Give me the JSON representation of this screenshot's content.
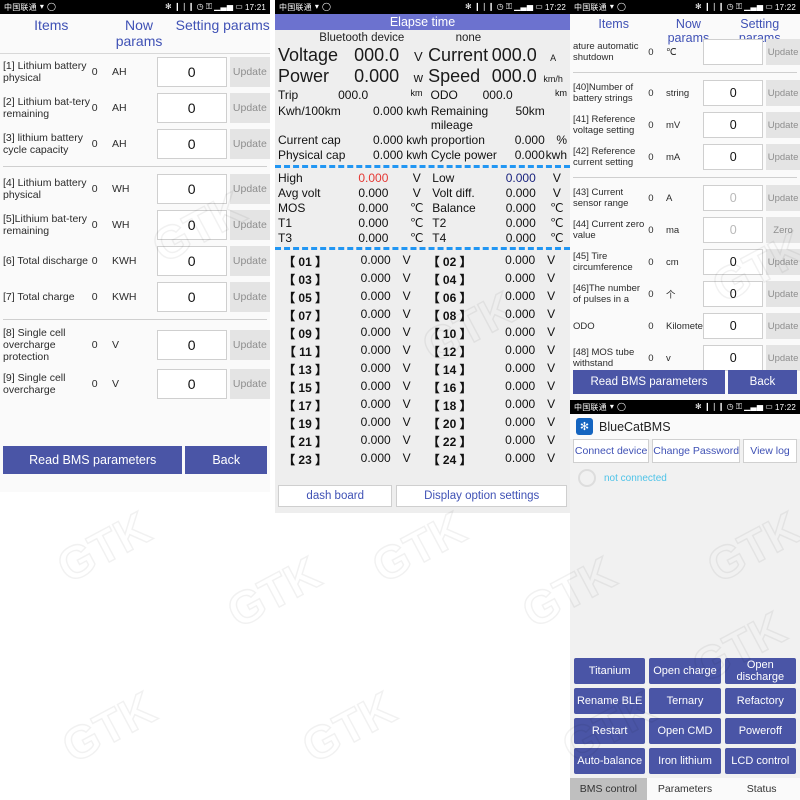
{
  "statusbar": {
    "carrier": "中国联通",
    "icons_left": [
      "signal-icon",
      "refresh-icon"
    ],
    "icons_right": [
      "bluetooth-icon",
      "vibrate-icon",
      "alarm-icon",
      "key-icon",
      "signal-bars-icon",
      "battery-icon"
    ],
    "time_left": "17:21",
    "time_right": "17:22"
  },
  "colors": {
    "accent": "#4a55a6",
    "header_text": "#3f51b5",
    "title_bar": "#6c72cf",
    "dash_divider": "#2196f3",
    "high_value": "#e53935",
    "low_value": "#1a237e",
    "status_text": "#4ec3e8",
    "logo": "#1565c0"
  },
  "panel_params_left": {
    "header": {
      "items": "Items",
      "now": "Now params",
      "setting": "Setting params"
    },
    "rows": [
      {
        "name": "[1] Lithium battery physical",
        "now": "0",
        "unit": "AH",
        "value": "0",
        "button": "Update"
      },
      {
        "name": "[2] Lithium bat-tery remaining",
        "now": "0",
        "unit": "AH",
        "value": "0",
        "button": "Update"
      },
      {
        "name": "[3] lithium battery cycle capacity",
        "now": "0",
        "unit": "AH",
        "value": "0",
        "button": "Update"
      },
      {
        "name": "[4] Lithium battery physical",
        "now": "0",
        "unit": "WH",
        "value": "0",
        "button": "Update"
      },
      {
        "name": "[5]Lithium bat-tery remaining",
        "now": "0",
        "unit": "WH",
        "value": "0",
        "button": "Update"
      },
      {
        "name": "[6] Total discharge",
        "now": "0",
        "unit": "KWH",
        "value": "0",
        "button": "Update"
      },
      {
        "name": "[7] Total charge",
        "now": "0",
        "unit": "KWH",
        "value": "0",
        "button": "Update"
      },
      {
        "name": "[8] Single cell overcharge protection",
        "now": "0",
        "unit": "V",
        "value": "0",
        "button": "Update"
      },
      {
        "name": "[9] Single cell overcharge",
        "now": "0",
        "unit": "V",
        "value": "0",
        "button": "Update"
      }
    ],
    "footer": {
      "read": "Read BMS parameters",
      "back": "Back"
    }
  },
  "panel_dashboard": {
    "title": "Elapse time",
    "bluetooth_label": "Bluetooth device",
    "bluetooth_value": "none",
    "rows_big": [
      {
        "l1": "Voltage",
        "v1": "000.0",
        "u1": "V",
        "l2": "Current",
        "v2": "000.0",
        "u2": "A"
      },
      {
        "l1": "Power",
        "v1": "0.000",
        "u1": "w",
        "l2": "Speed",
        "v2": "000.0",
        "u2": "km/h"
      }
    ],
    "row_trip": {
      "l1": "Trip",
      "v1": "000.0",
      "u1": "km",
      "l2": "ODO",
      "v2": "000.0",
      "u2": "km"
    },
    "rows_small": [
      {
        "l1": "Kwh/100km",
        "v1": "0.000",
        "u1": "kwh",
        "l2": "Remaining mileage",
        "v2": "50km",
        "u2": ""
      },
      {
        "l1": "Current cap",
        "v1": "0.000",
        "u1": "kwh",
        "l2": "proportion",
        "v2": "0.000",
        "u2": "%"
      },
      {
        "l1": "Physical cap",
        "v1": "0.000",
        "u1": "kwh",
        "l2": "Cycle power",
        "v2": "0.000",
        "u2": "kwh"
      }
    ],
    "stats": [
      {
        "l1": "High",
        "v1": "0.000",
        "u1": "V",
        "c1": "high",
        "l2": "Low",
        "v2": "0.000",
        "u2": "V",
        "c2": "low"
      },
      {
        "l1": "Avg volt",
        "v1": "0.000",
        "u1": "V",
        "c1": "",
        "l2": "Volt diff.",
        "v2": "0.000",
        "u2": "V",
        "c2": ""
      },
      {
        "l1": "MOS",
        "v1": "0.000",
        "u1": "℃",
        "c1": "",
        "l2": "Balance",
        "v2": "0.000",
        "u2": "℃",
        "c2": ""
      },
      {
        "l1": "T1",
        "v1": "0.000",
        "u1": "℃",
        "c1": "",
        "l2": "T2",
        "v2": "0.000",
        "u2": "℃",
        "c2": ""
      },
      {
        "l1": "T3",
        "v1": "0.000",
        "u1": "℃",
        "c1": "",
        "l2": "T4",
        "v2": "0.000",
        "u2": "℃",
        "c2": ""
      }
    ],
    "cells": [
      {
        "i1": "【 01 】",
        "v1": "0.000",
        "u1": "V",
        "i2": "【 02 】",
        "v2": "0.000",
        "u2": "V"
      },
      {
        "i1": "【 03 】",
        "v1": "0.000",
        "u1": "V",
        "i2": "【 04 】",
        "v2": "0.000",
        "u2": "V"
      },
      {
        "i1": "【 05 】",
        "v1": "0.000",
        "u1": "V",
        "i2": "【 06 】",
        "v2": "0.000",
        "u2": "V"
      },
      {
        "i1": "【 07 】",
        "v1": "0.000",
        "u1": "V",
        "i2": "【 08 】",
        "v2": "0.000",
        "u2": "V"
      },
      {
        "i1": "【 09 】",
        "v1": "0.000",
        "u1": "V",
        "i2": "【 10 】",
        "v2": "0.000",
        "u2": "V"
      },
      {
        "i1": "【 11 】",
        "v1": "0.000",
        "u1": "V",
        "i2": "【 12 】",
        "v2": "0.000",
        "u2": "V"
      },
      {
        "i1": "【 13 】",
        "v1": "0.000",
        "u1": "V",
        "i2": "【 14 】",
        "v2": "0.000",
        "u2": "V"
      },
      {
        "i1": "【 15 】",
        "v1": "0.000",
        "u1": "V",
        "i2": "【 16 】",
        "v2": "0.000",
        "u2": "V"
      },
      {
        "i1": "【 17 】",
        "v1": "0.000",
        "u1": "V",
        "i2": "【 18 】",
        "v2": "0.000",
        "u2": "V"
      },
      {
        "i1": "【 19 】",
        "v1": "0.000",
        "u1": "V",
        "i2": "【 20 】",
        "v2": "0.000",
        "u2": "V"
      },
      {
        "i1": "【 21 】",
        "v1": "0.000",
        "u1": "V",
        "i2": "【 22 】",
        "v2": "0.000",
        "u2": "V"
      },
      {
        "i1": "【 23 】",
        "v1": "0.000",
        "u1": "V",
        "i2": "【 24 】",
        "v2": "0.000",
        "u2": "V"
      }
    ],
    "footer": {
      "dash": "dash board",
      "display": "Display option settings"
    }
  },
  "panel_params_right": {
    "header": {
      "items": "Items",
      "now": "Now params",
      "setting": "Setting params"
    },
    "rows": [
      {
        "name": "ature automatic shutdown",
        "now": "0",
        "unit": "℃",
        "value": "",
        "button": "Update",
        "clipped": true
      },
      {
        "name": "[40]Number of battery strings",
        "now": "0",
        "unit": "string",
        "value": "0",
        "button": "Update"
      },
      {
        "name": "[41] Reference voltage setting",
        "now": "0",
        "unit": "mV",
        "value": "0",
        "button": "Update"
      },
      {
        "name": "[42] Reference current setting",
        "now": "0",
        "unit": "mA",
        "value": "0",
        "button": "Update"
      },
      {
        "name": "[43] Current sensor range",
        "now": "0",
        "unit": "A",
        "value": "0",
        "button": "Update",
        "dim": true
      },
      {
        "name": "[44] Current zero value",
        "now": "0",
        "unit": "ma",
        "value": "0",
        "button": "Zero",
        "dim": true
      },
      {
        "name": "[45] Tire circumference",
        "now": "0",
        "unit": "cm",
        "value": "0",
        "button": "Update"
      },
      {
        "name": "[46]The number of pulses in a",
        "now": "0",
        "unit": "个",
        "value": "0",
        "button": "Update"
      },
      {
        "name": "ODO",
        "now": "0",
        "unit": "Kilometer",
        "value": "0",
        "button": "Update"
      },
      {
        "name": "[48] MOS tube withstand",
        "now": "0",
        "unit": "v",
        "value": "0",
        "button": "Update"
      }
    ],
    "footer": {
      "read": "Read BMS parameters",
      "back": "Back"
    }
  },
  "panel_bms_control": {
    "app_title": "BlueCatBMS",
    "logo_icon": "bluetooth-icon",
    "tools": [
      "Connect device",
      "Change Password",
      "View log"
    ],
    "connection_status": "not connected",
    "buttons": [
      "Titanium",
      "Open charge",
      "Open discharge",
      "Rename BLE",
      "Ternary",
      "Refactory",
      "Restart",
      "Open CMD",
      "Poweroff",
      "Auto-balance",
      "Iron lithium",
      "LCD control"
    ],
    "tabs": [
      {
        "label": "BMS control",
        "active": true
      },
      {
        "label": "Parameters",
        "active": false
      },
      {
        "label": "Status",
        "active": false
      }
    ]
  },
  "watermark": {
    "text": "GTK"
  }
}
